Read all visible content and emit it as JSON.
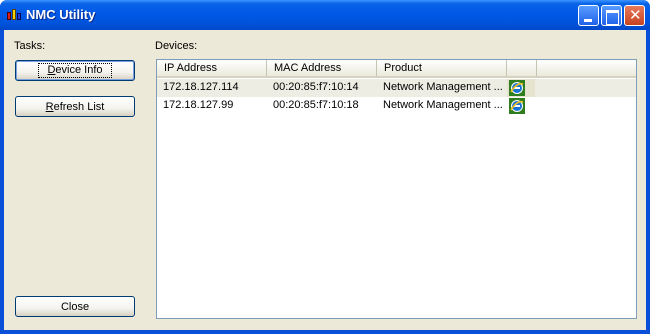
{
  "window": {
    "title": "NMC Utility"
  },
  "tasks": {
    "label": "Tasks:",
    "buttons": [
      {
        "label": "Device Info",
        "mnemonic": "D"
      },
      {
        "label": "Refresh List",
        "mnemonic": "R"
      },
      {
        "label": "Close"
      }
    ]
  },
  "devices": {
    "label": "Devices:",
    "columns": [
      "IP Address",
      "MAC Address",
      "Product",
      ""
    ],
    "rows": [
      {
        "ip": "172.18.127.114",
        "mac": "00:20:85:f7:10:14",
        "product": "Network Management ...",
        "icon": "internet-explorer-icon"
      },
      {
        "ip": "172.18.127.99",
        "mac": "00:20:85:f7:10:18",
        "product": "Network Management ...",
        "icon": "internet-explorer-icon"
      }
    ]
  },
  "colors": {
    "titlebar": "#0054dc",
    "client": "#ece9d8",
    "selection": "#eeede4"
  }
}
